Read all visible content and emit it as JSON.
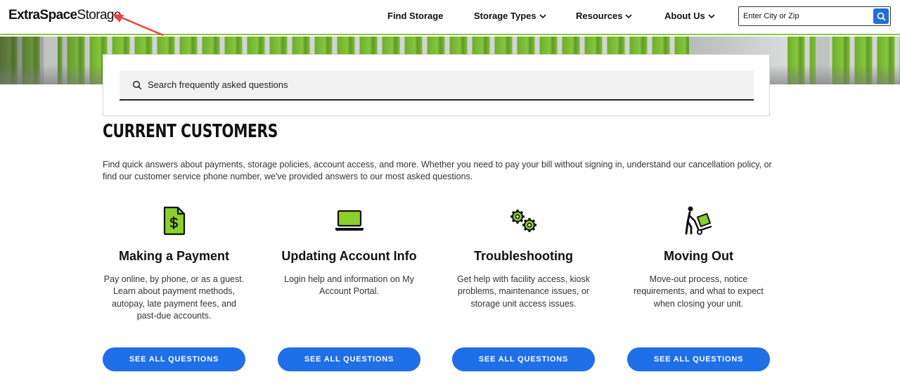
{
  "header": {
    "logo_bold": "ExtraSpace",
    "logo_light": "Storage",
    "nav": [
      {
        "label": "Find Storage"
      },
      {
        "label": "Storage Types"
      },
      {
        "label": "Resources"
      },
      {
        "label": "About Us"
      }
    ],
    "city_search": {
      "placeholder": "Enter City or Zip",
      "value": ""
    }
  },
  "faq_search": {
    "placeholder": "Search frequently asked questions",
    "value": ""
  },
  "section": {
    "title": "CURRENT CUSTOMERS",
    "intro": "Find quick answers about payments, storage policies, account access, and more. Whether you need to pay your bill without signing in, understand our cancellation policy, or find our customer service phone number, we've provided answers to our most asked questions."
  },
  "cards": [
    {
      "icon": "payment-document-icon",
      "title": "Making a Payment",
      "text": "Pay online, by phone, or as a guest. Learn about payment methods, autopay, late payment fees, and past-due accounts.",
      "button": "SEE ALL QUESTIONS"
    },
    {
      "icon": "laptop-icon",
      "title": "Updating Account Info",
      "text": "Login help and information on My Account Portal.",
      "button": "SEE ALL QUESTIONS"
    },
    {
      "icon": "gears-icon",
      "title": "Troubleshooting",
      "text": "Get help with facility access, kiosk problems, maintenance issues, or storage unit access issues.",
      "button": "SEE ALL QUESTIONS"
    },
    {
      "icon": "moving-dolly-icon",
      "title": "Moving Out",
      "text": "Move-out process, notice requirements, and what to expect when closing your unit.",
      "button": "SEE ALL QUESTIONS"
    }
  ],
  "colors": {
    "brand_green": "#8cc63f",
    "button_blue": "#1f6fe8",
    "annotation_red": "#e8453c"
  }
}
